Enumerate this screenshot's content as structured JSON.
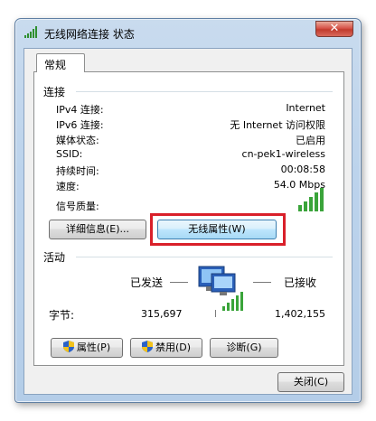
{
  "window": {
    "title": "无线网络连接 状态",
    "close_glyph": "✕",
    "icon": "wireless-signal-icon"
  },
  "tabs": [
    {
      "label": "常规"
    }
  ],
  "connection": {
    "heading": "连接",
    "rows": [
      {
        "label": "IPv4 连接:",
        "value": "Internet"
      },
      {
        "label": "IPv6 连接:",
        "value": "无 Internet 访问权限"
      },
      {
        "label": "媒体状态:",
        "value": "已启用"
      },
      {
        "label": "SSID:",
        "value": "cn-pek1-wireless"
      },
      {
        "label": "持续时间:",
        "value": "00:08:58"
      },
      {
        "label": "速度:",
        "value": "54.0 Mbps"
      }
    ],
    "signal_label": "信号质量:",
    "signal_icon": "signal-bars-icon",
    "details_button": "详细信息(E)...",
    "wireless_props_button": "无线属性(W)"
  },
  "activity": {
    "heading": "活动",
    "sent_label": "已发送",
    "received_label": "已接收",
    "bytes_label": "字节:",
    "bytes_sent": "315,697",
    "bytes_received": "1,402,155",
    "network_icon": "network-computers-icon"
  },
  "actions": {
    "properties_button": "属性(P)",
    "disable_button": "禁用(D)",
    "diagnose_button": "诊断(G)"
  },
  "footer": {
    "close_button": "关闭(C)"
  },
  "colors": {
    "highlight": "#d9202a",
    "signal_green": "#3aa43a"
  }
}
